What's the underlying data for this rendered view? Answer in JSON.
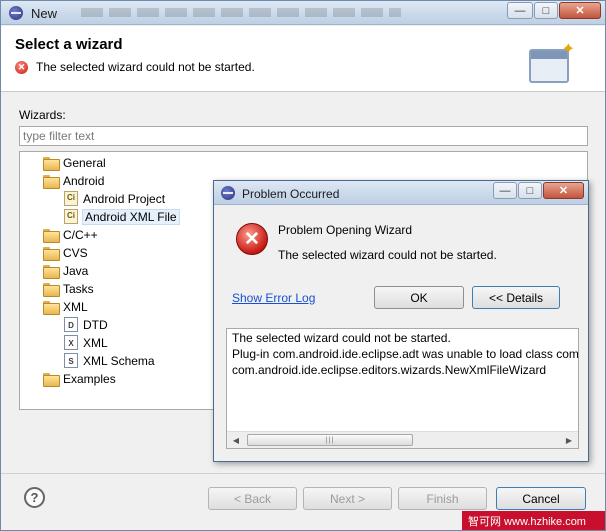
{
  "window": {
    "title": "New",
    "controls": [
      "minimize",
      "maximize",
      "close"
    ]
  },
  "header": {
    "title": "Select a wizard",
    "error_message": "The selected wizard could not be started."
  },
  "wizards": {
    "label": "Wizards:",
    "filter_placeholder": "type filter text",
    "tree": [
      {
        "label": "General",
        "icon": "folder-icon"
      },
      {
        "label": "Android",
        "icon": "folder-icon",
        "expanded": true,
        "children": [
          {
            "label": "Android Project",
            "icon": "android-project-icon"
          },
          {
            "label": "Android XML File",
            "icon": "android-xml-icon",
            "selected": true
          }
        ]
      },
      {
        "label": "C/C++",
        "icon": "folder-icon"
      },
      {
        "label": "CVS",
        "icon": "folder-icon"
      },
      {
        "label": "Java",
        "icon": "folder-icon"
      },
      {
        "label": "Tasks",
        "icon": "folder-icon"
      },
      {
        "label": "XML",
        "icon": "folder-icon",
        "expanded": true,
        "children": [
          {
            "label": "DTD",
            "icon": "dtd-icon"
          },
          {
            "label": "XML",
            "icon": "xml-icon"
          },
          {
            "label": "XML Schema",
            "icon": "xml-schema-icon"
          }
        ]
      },
      {
        "label": "Examples",
        "icon": "folder-icon"
      }
    ]
  },
  "footer": {
    "back": "< Back",
    "next": "Next >",
    "finish": "Finish",
    "cancel": "Cancel"
  },
  "dialog": {
    "title": "Problem Occurred",
    "heading": "Problem Opening Wizard",
    "message": "The selected wizard could not be started.",
    "link": "Show Error Log",
    "ok": "OK",
    "details_button": "<< Details",
    "details": [
      "The selected wizard could not be started.",
      "  Plug-in com.android.ide.eclipse.adt was unable to load class com",
      "  com.android.ide.eclipse.editors.wizards.NewXmlFileWizard"
    ]
  },
  "watermark": "智可网 www.hzhike.com"
}
